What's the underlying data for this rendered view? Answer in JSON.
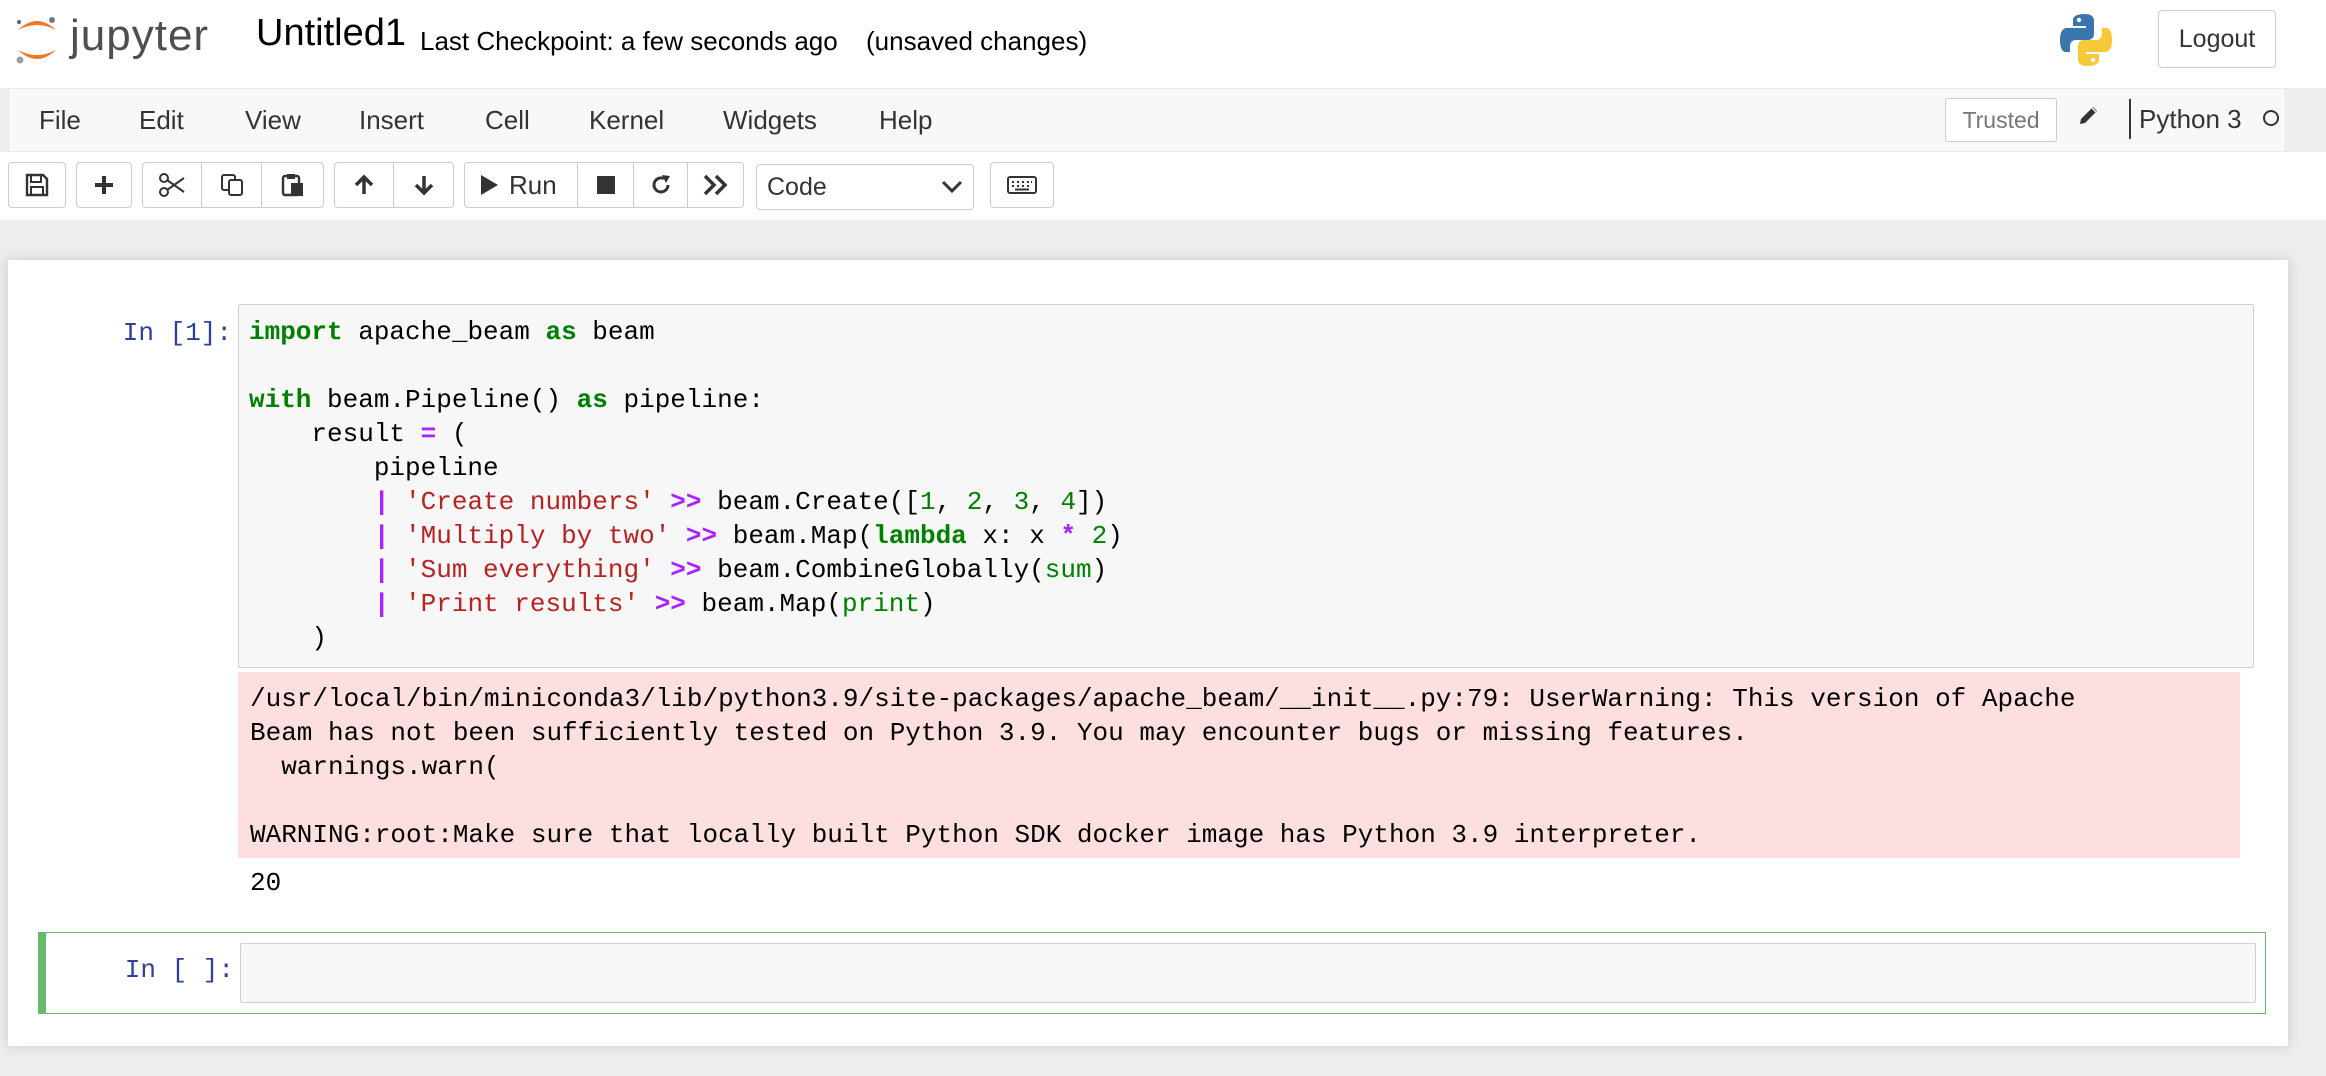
{
  "header": {
    "logo_text": "jupyter",
    "notebook_name": "Untitled1",
    "checkpoint": "Last Checkpoint: a few seconds ago",
    "autosave_status": "(unsaved changes)",
    "logout_label": "Logout"
  },
  "menubar": {
    "items": [
      "File",
      "Edit",
      "View",
      "Insert",
      "Cell",
      "Kernel",
      "Widgets",
      "Help"
    ],
    "trusted_label": "Trusted",
    "kernel_name": "Python 3"
  },
  "toolbar": {
    "run_label": "Run",
    "cell_type": "Code",
    "cell_type_options": [
      "Code"
    ]
  },
  "cells": [
    {
      "prompt": "In [1]:",
      "code_lines": [
        "import apache_beam as beam",
        "",
        "with beam.Pipeline() as pipeline:",
        "    result = (",
        "        pipeline",
        "        | 'Create numbers' >> beam.Create([1, 2, 3, 4])",
        "        | 'Multiply by two' >> beam.Map(lambda x: x * 2)",
        "        | 'Sum everything' >> beam.CombineGlobally(sum)",
        "        | 'Print results' >> beam.Map(print)",
        "    )"
      ],
      "stderr": "/usr/local/bin/miniconda3/lib/python3.9/site-packages/apache_beam/__init__.py:79: UserWarning: This version of Apache\nBeam has not been sufficiently tested on Python 3.9. You may encounter bugs or missing features.\n  warnings.warn(\n\nWARNING:root:Make sure that locally built Python SDK docker image has Python 3.9 interpreter.",
      "stdout": "20"
    },
    {
      "prompt": "In [ ]:",
      "code": ""
    }
  ],
  "colors": {
    "keyword": "#008000",
    "operator": "#aa22ff",
    "string": "#ba2121",
    "prompt": "#303f9f",
    "stderr_bg": "#fddfdf",
    "selected_cell_border": "#66bb6a"
  }
}
